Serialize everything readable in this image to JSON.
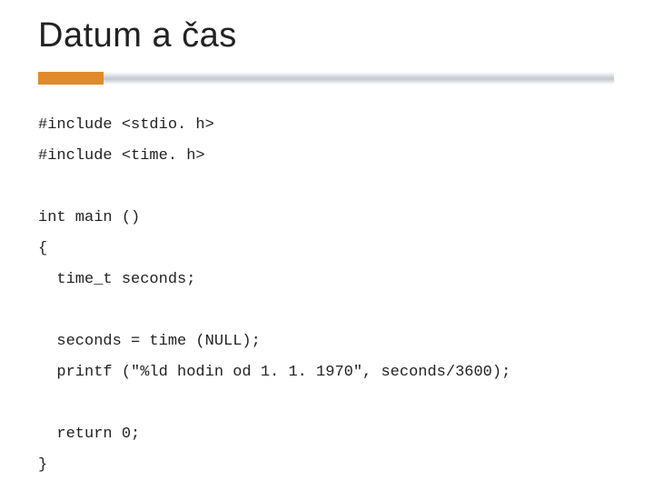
{
  "slide": {
    "title": "Datum a čas",
    "code": {
      "line1": "#include <stdio. h>",
      "line2": "#include <time. h>",
      "blank1": "",
      "line3": "int main ()",
      "line4": "{",
      "line5": "  time_t seconds;",
      "blank2": "",
      "line6": "  seconds = time (NULL);",
      "line7": "  printf (\"%ld hodin od 1. 1. 1970\", seconds/3600);",
      "blank3": "",
      "line8": "  return 0;",
      "line9": "}"
    }
  }
}
